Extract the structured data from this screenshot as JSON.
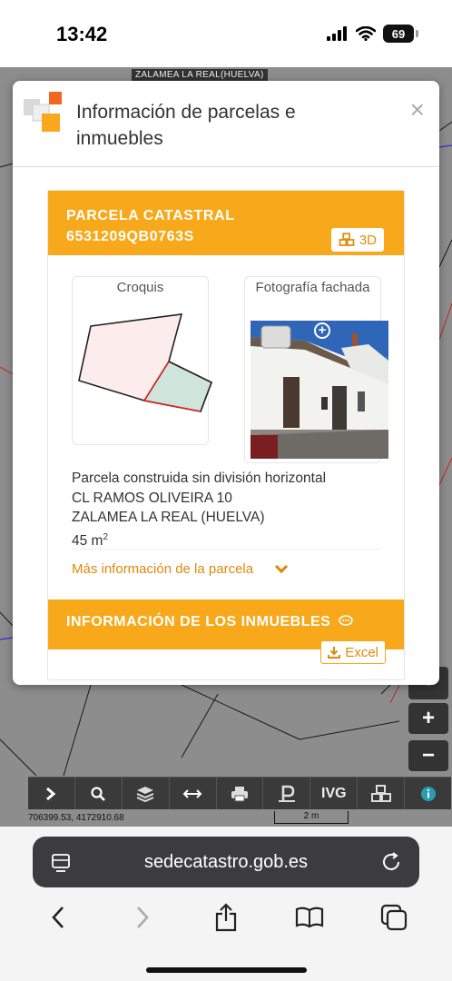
{
  "status_bar": {
    "time": "13:42",
    "battery": "69"
  },
  "map": {
    "place_label": "ZALAMEA LA REAL(HUELVA)",
    "coordinates": "706399.53, 4172910.68",
    "scale": "2 m",
    "zoom_in": "+",
    "zoom_out": "−",
    "toolbar": [
      {
        "name": "expand",
        "icon": "chevron-right-icon"
      },
      {
        "name": "search",
        "icon": "search-icon"
      },
      {
        "name": "layers",
        "icon": "layers-icon"
      },
      {
        "name": "measure",
        "icon": "measure-icon"
      },
      {
        "name": "print",
        "icon": "print-icon"
      },
      {
        "name": "parcel",
        "icon": "parcel-icon"
      },
      {
        "name": "ivg",
        "label": "IVG"
      },
      {
        "name": "3d",
        "icon": "cubes-icon"
      },
      {
        "name": "info",
        "icon": "info-icon"
      }
    ]
  },
  "modal": {
    "title": "Información de parcelas e inmuebles",
    "close": "×",
    "parcel": {
      "header_line1": "PARCELA CATASTRAL",
      "ref": "6531209QB0763S",
      "btn_3d": "3D",
      "sketch_label": "Croquis",
      "photo_label": "Fotografía fachada",
      "type": "Parcela construida sin división horizontal",
      "address": "CL RAMOS OLIVEIRA 10",
      "municipality": "ZALAMEA LA REAL (HUELVA)",
      "area": "45 m",
      "area_unit_sup": "2",
      "more_info": "Más información de la parcela"
    },
    "properties": {
      "header": "INFORMACIÓN DE LOS INMUEBLES",
      "excel": "Excel"
    }
  },
  "browser": {
    "url": "sedecatastro.gob.es"
  },
  "colors": {
    "accent": "#f7a81b",
    "accent_text": "#e0880b",
    "map_bg": "#8d8d8d",
    "toolbar_bg": "#3a3a3a"
  }
}
